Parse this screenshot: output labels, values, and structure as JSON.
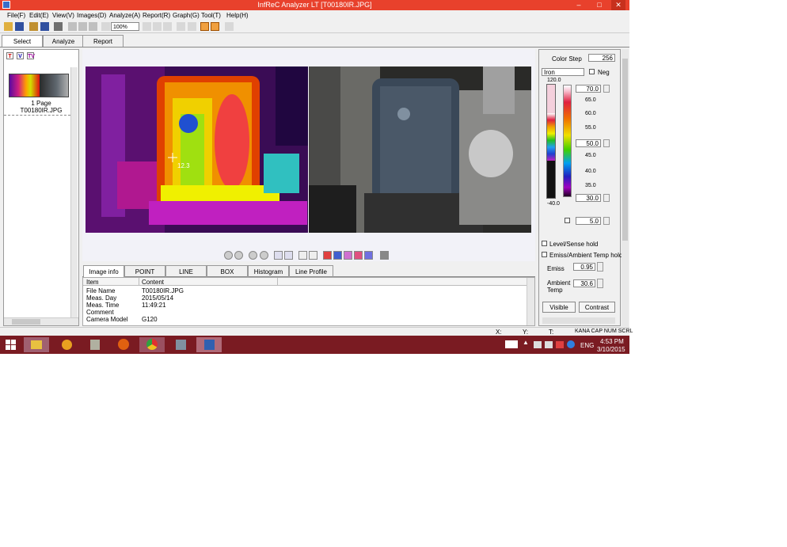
{
  "window": {
    "title": "InfReC Analyzer LT [T00180IR.JPG]",
    "minimize": "–",
    "maximize": "□",
    "close": "✕"
  },
  "menu": [
    "File(F)",
    "Edit(E)",
    "View(V)",
    "Images(D)",
    "Analyze(A)",
    "Report(R)",
    "Graph(G)",
    "Tool(T)",
    "Help(H)"
  ],
  "toolbar": {
    "zoom": "100%"
  },
  "tabs": [
    "Select",
    "Analyze",
    "Report"
  ],
  "left_panel": {
    "thumb_page": "1 Page",
    "thumb_name": "T00180IR.JPG"
  },
  "info_tabs": [
    "Image info",
    "POINT",
    "LINE",
    "BOX",
    "Histogram",
    "Line Profile"
  ],
  "info_table": {
    "headers": [
      "Item",
      "Content"
    ],
    "rows": [
      [
        "File Name",
        "T00180IR.JPG"
      ],
      [
        "Meas. Day",
        "2015/05/14"
      ],
      [
        "Meas. Time",
        "11:49:21"
      ],
      [
        "Comment",
        ""
      ],
      [
        "Camera Model",
        "G120"
      ]
    ]
  },
  "ir_marker_label": "12.3",
  "right_panel": {
    "color_step_label": "Color Step",
    "color_step_value": "256",
    "palette": "Iron",
    "neg_label": "Neg",
    "scale_top": "120.0",
    "scale_bottom": "-40.0",
    "upper_value": "70.0",
    "mid_value": "50.0",
    "lower_value": "30.0",
    "step_value": "5.0",
    "ticks": [
      "65.0",
      "60.0",
      "55.0",
      "50.0",
      "45.0",
      "40.0",
      "35.0"
    ],
    "level_hold": "Level/Sense hold",
    "emiss_hold": "Emiss/Ambient Temp hold",
    "emiss_label": "Emiss",
    "emiss_value": "0.95",
    "ambient_label": "Ambient Temp",
    "ambient_value": "30.6",
    "visible_btn": "Visible",
    "contrast_btn": "Contrast"
  },
  "status": {
    "x": "X:",
    "y": "Y:",
    "t": "T:",
    "keys": "KANA CAP NUM SCRL"
  },
  "taskbar": {
    "lang": "ENG",
    "time": "4:53 PM",
    "date": "3/10/2015"
  }
}
